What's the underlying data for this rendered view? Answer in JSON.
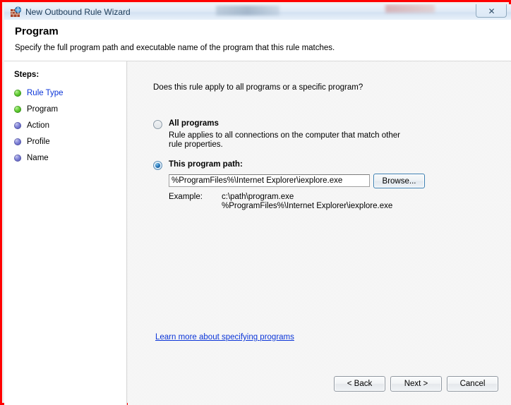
{
  "window": {
    "title": "New Outbound Rule Wizard",
    "icon": "firewall-globe-icon",
    "close_label": "✕"
  },
  "header": {
    "title": "Program",
    "subtitle": "Specify the full program path and executable name of the program that this rule matches."
  },
  "sidebar": {
    "heading": "Steps:",
    "items": [
      {
        "label": "Rule Type",
        "state": "done",
        "is_link": true
      },
      {
        "label": "Program",
        "state": "done",
        "is_link": false
      },
      {
        "label": "Action",
        "state": "pending",
        "is_link": false
      },
      {
        "label": "Profile",
        "state": "pending",
        "is_link": false
      },
      {
        "label": "Name",
        "state": "pending",
        "is_link": false
      }
    ]
  },
  "main": {
    "question": "Does this rule apply to all programs or a specific program?",
    "option_all": {
      "title": "All programs",
      "description": "Rule applies to all connections on the computer that match other rule properties.",
      "selected": false
    },
    "option_path": {
      "title": "This program path:",
      "selected": true,
      "input_value": "%ProgramFiles%\\Internet Explorer\\iexplore.exe",
      "input_placeholder": "",
      "browse_label": "Browse...",
      "example_label": "Example:",
      "example_lines": "c:\\path\\program.exe\n%ProgramFiles%\\Internet Explorer\\iexplore.exe"
    },
    "learn_more_link": "Learn more about specifying programs"
  },
  "footer": {
    "back_label": "< Back",
    "next_label": "Next >",
    "cancel_label": "Cancel"
  },
  "colors": {
    "link": "#0b35d8",
    "annotation_border": "#ff0000",
    "step_done": "#63cc33",
    "step_pending": "#7d80d6",
    "focus_ring": "#3c7fb1"
  }
}
